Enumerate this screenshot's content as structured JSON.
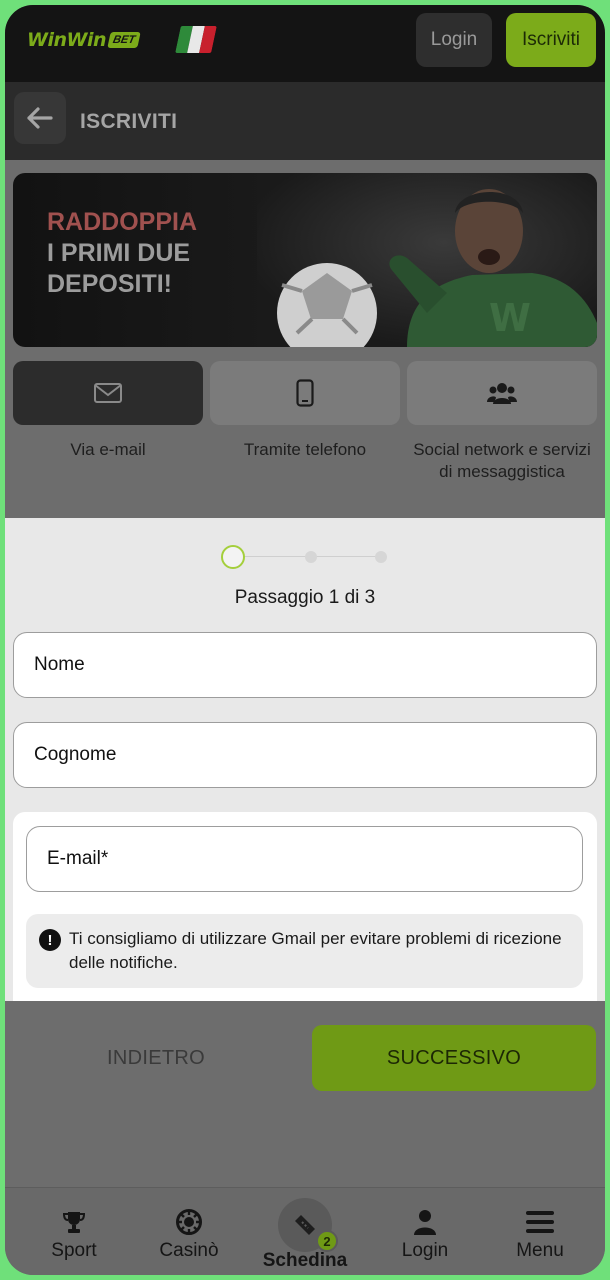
{
  "topbar": {
    "logo_word": "WinWin",
    "logo_badge": "BET",
    "login_label": "Login",
    "signup_label": "Iscriviti"
  },
  "header": {
    "title": "ISCRIVITI"
  },
  "banner": {
    "line1": "RADDOPPIA",
    "line2": "I PRIMI DUE",
    "line3": "DEPOSITI!"
  },
  "methods": [
    {
      "label": "Via e-mail",
      "icon": "envelope-icon",
      "selected": true
    },
    {
      "label": "Tramite telefono",
      "icon": "smartphone-icon",
      "selected": false
    },
    {
      "label": "Social network e servizi di messaggistica",
      "icon": "users-icon",
      "selected": false
    }
  ],
  "form": {
    "step_text": "Passaggio 1 di 3",
    "current_step": 1,
    "total_steps": 3,
    "first_name_placeholder": "Nome",
    "last_name_placeholder": "Cognome",
    "email_placeholder": "E-mail*",
    "notice": "Ti consigliamo di utilizzare Gmail per evitare problemi di ricezione delle notifiche."
  },
  "actions": {
    "back_label": "INDIETRO",
    "next_label": "SUCCESSIVO"
  },
  "bottom_nav": {
    "items": [
      {
        "label": "Sport",
        "icon": "trophy-icon"
      },
      {
        "label": "Casinò",
        "icon": "casino-chip-icon"
      },
      {
        "label": "Schedina",
        "icon": "ticket-icon",
        "badge": "2"
      },
      {
        "label": "Login",
        "icon": "user-icon"
      },
      {
        "label": "Menu",
        "icon": "menu-icon"
      }
    ]
  },
  "colors": {
    "accent": "#7cab1a",
    "frame": "#6fe07a"
  }
}
